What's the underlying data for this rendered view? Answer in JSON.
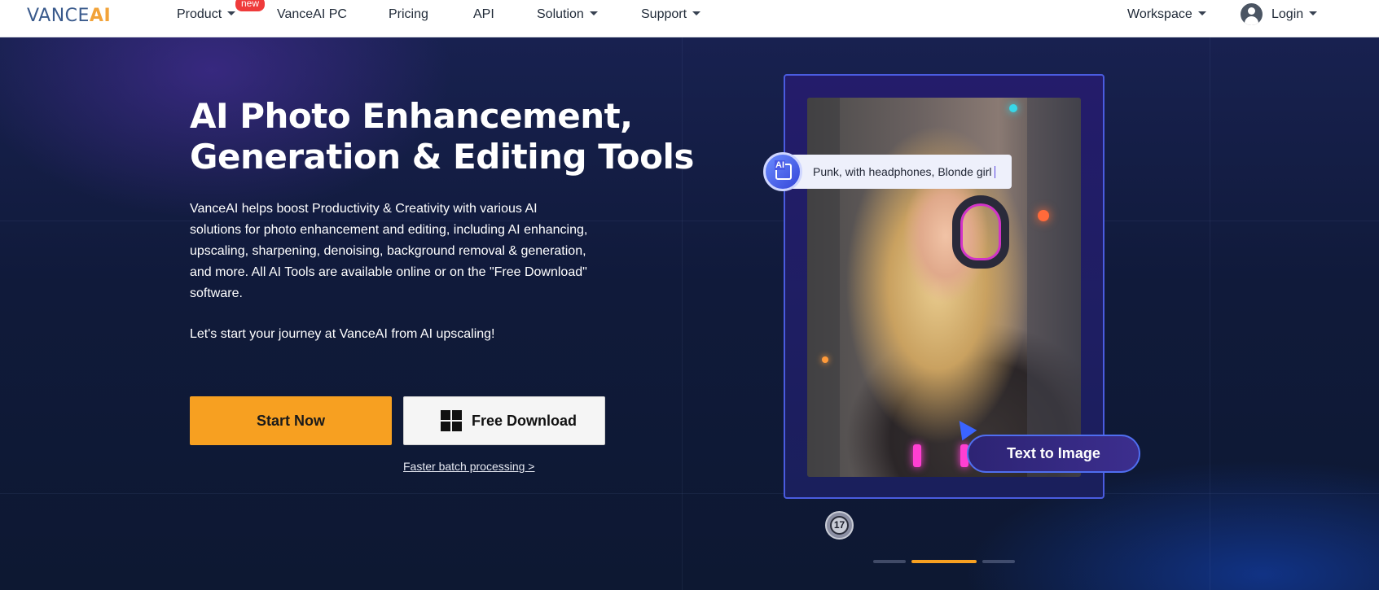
{
  "nav": {
    "logo_vance": "VANCE",
    "logo_ai": "AI",
    "items": [
      {
        "label": "Product"
      },
      {
        "label": "VanceAI PC"
      },
      {
        "label": "Pricing"
      },
      {
        "label": "API"
      },
      {
        "label": "Solution"
      },
      {
        "label": "Support"
      }
    ],
    "new_badge": "new",
    "workspace": "Workspace",
    "login": "Login"
  },
  "hero": {
    "headline_line1": "AI Photo Enhancement,",
    "headline_line2": "Generation & Editing Tools",
    "description": "VanceAI helps boost Productivity & Creativity with various AI solutions for photo enhancement and editing, including AI enhancing, upscaling, sharpening, denoising, background removal & generation, and more. All AI Tools are available online or on the \"Free Download\" software.",
    "journey": "Let's start your journey at VanceAI from AI upscaling!",
    "start_button": "Start Now",
    "download_button": "Free Download",
    "faster_link": "Faster batch processing >"
  },
  "showcase": {
    "prompt_text": "Punk, with headphones, Blonde girl",
    "ai_badge": "AI",
    "text_to_image_button": "Text to Image",
    "chat_count": "17",
    "active_slide": 2,
    "slide_count": 3
  },
  "colors": {
    "accent_orange": "#f7a021",
    "logo_blue": "#3a5a8c",
    "badge_red": "#ef3b3b",
    "card_border": "#4a5ce0"
  }
}
